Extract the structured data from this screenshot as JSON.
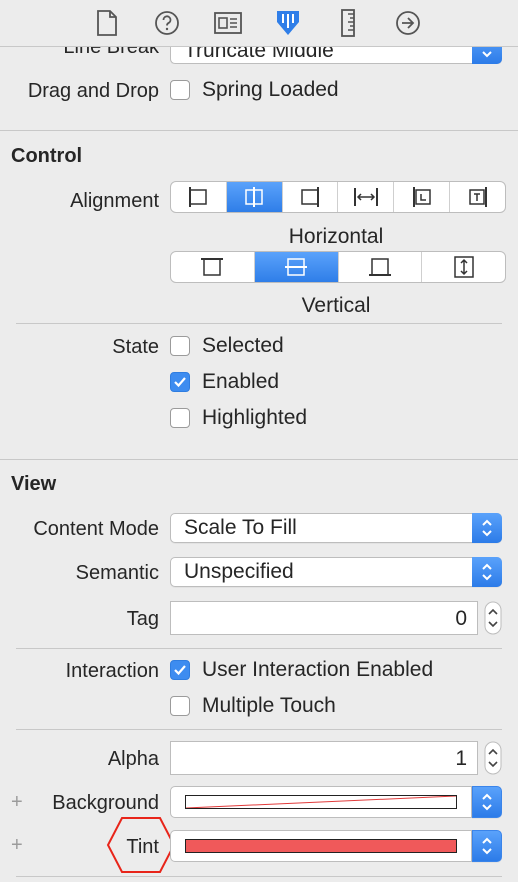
{
  "toolbar": {
    "icons": [
      "file-icon",
      "help-icon",
      "identity-icon",
      "attributes-icon",
      "ruler-icon",
      "connections-icon"
    ],
    "active_icon": "attributes-icon",
    "accent": "#3d8cf0"
  },
  "top": {
    "line_break_label": "Line Break",
    "line_break_value": "Truncate Middle",
    "drag_drop_label": "Drag and Drop",
    "spring_loaded_label": "Spring Loaded",
    "spring_loaded_checked": false
  },
  "control": {
    "title": "Control",
    "alignment_label": "Alignment",
    "horizontal_caption": "Horizontal",
    "vertical_caption": "Vertical",
    "horizontal_selected_index": 1,
    "vertical_selected_index": 1,
    "state_label": "State",
    "states": [
      {
        "label": "Selected",
        "checked": false
      },
      {
        "label": "Enabled",
        "checked": true
      },
      {
        "label": "Highlighted",
        "checked": false
      }
    ]
  },
  "view": {
    "title": "View",
    "content_mode_label": "Content Mode",
    "content_mode_value": "Scale To Fill",
    "semantic_label": "Semantic",
    "semantic_value": "Unspecified",
    "tag_label": "Tag",
    "tag_value": "0",
    "interaction_label": "Interaction",
    "user_interaction_label": "User Interaction Enabled",
    "user_interaction_checked": true,
    "multiple_touch_label": "Multiple Touch",
    "multiple_touch_checked": false,
    "alpha_label": "Alpha",
    "alpha_value": "1",
    "plus_glyph": "+",
    "background_label": "Background",
    "background_color": "default (no color)",
    "tint_label": "Tint",
    "tint_color": "#f0595a",
    "tint_highlight_color": "#e8251a"
  }
}
